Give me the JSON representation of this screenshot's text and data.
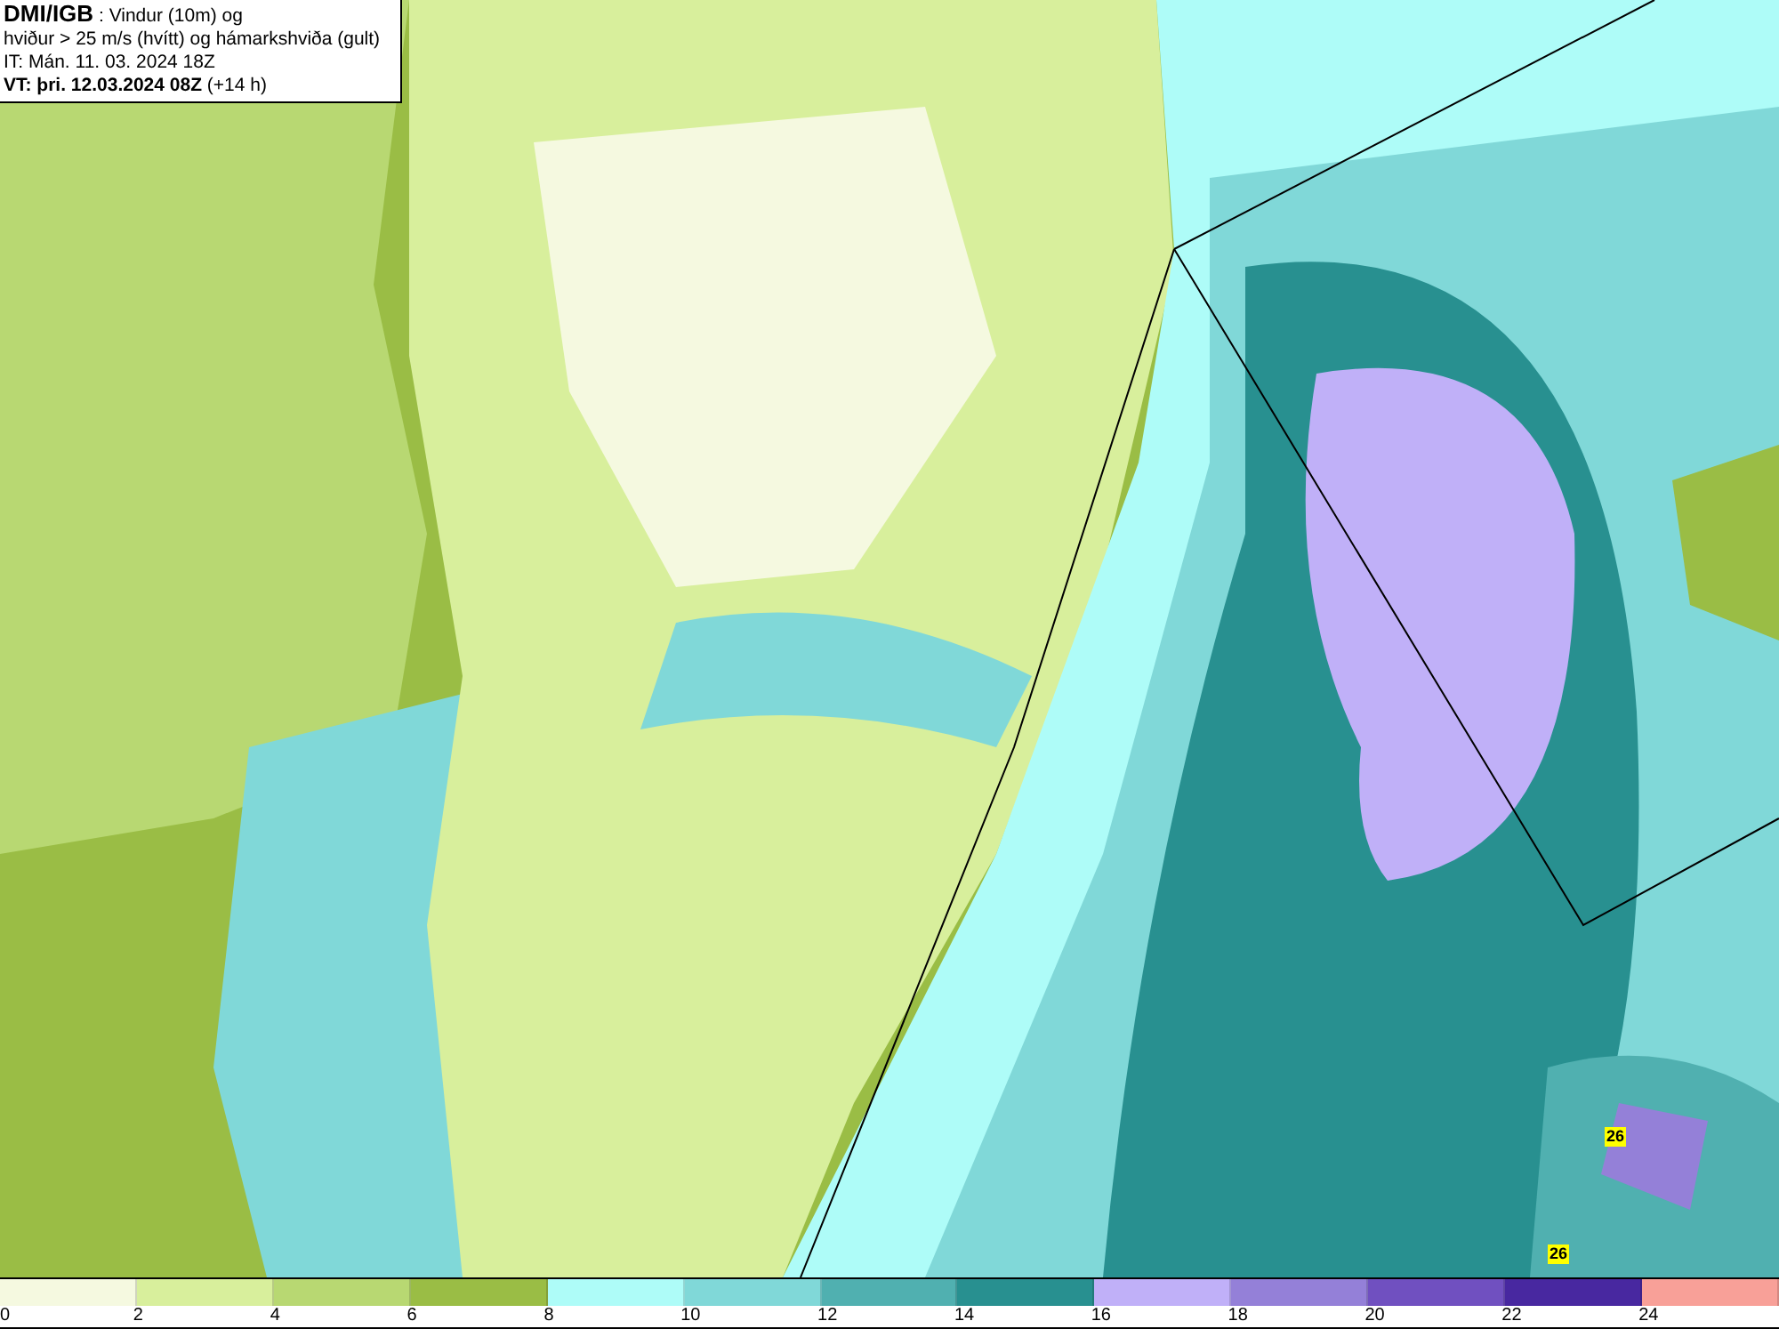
{
  "info_box": {
    "title": "DMI/IGB",
    "title_rest": " : Vindur (10m) og",
    "line_2": "hviður > 25 m/s (hvítt) og hámarkshviða (gult)",
    "line_3": "IT: Mán. 11. 03. 2024 18Z",
    "valid_time": "VT: þri. 12.03.2024 08Z",
    "valid_offset": " (+14 h)"
  },
  "map": {
    "gust_labels": [
      {
        "text": "26"
      },
      {
        "text": "26"
      }
    ]
  },
  "legend": {
    "bins": [
      {
        "color": "#f5f9e0"
      },
      {
        "color": "#d8ef9c"
      },
      {
        "color": "#b8d872"
      },
      {
        "color": "#9abd45"
      },
      {
        "color": "#aefcf8"
      },
      {
        "color": "#80d8d8"
      },
      {
        "color": "#50b0b0"
      },
      {
        "color": "#289090"
      },
      {
        "color": "#c0b0f8"
      },
      {
        "color": "#9480d8"
      },
      {
        "color": "#7050c0"
      },
      {
        "color": "#4828a0"
      },
      {
        "color": "#f8a098"
      }
    ],
    "ticks": [
      "0",
      "2",
      "4",
      "6",
      "8",
      "10",
      "12",
      "14",
      "16",
      "18",
      "20",
      "22",
      "24"
    ]
  }
}
